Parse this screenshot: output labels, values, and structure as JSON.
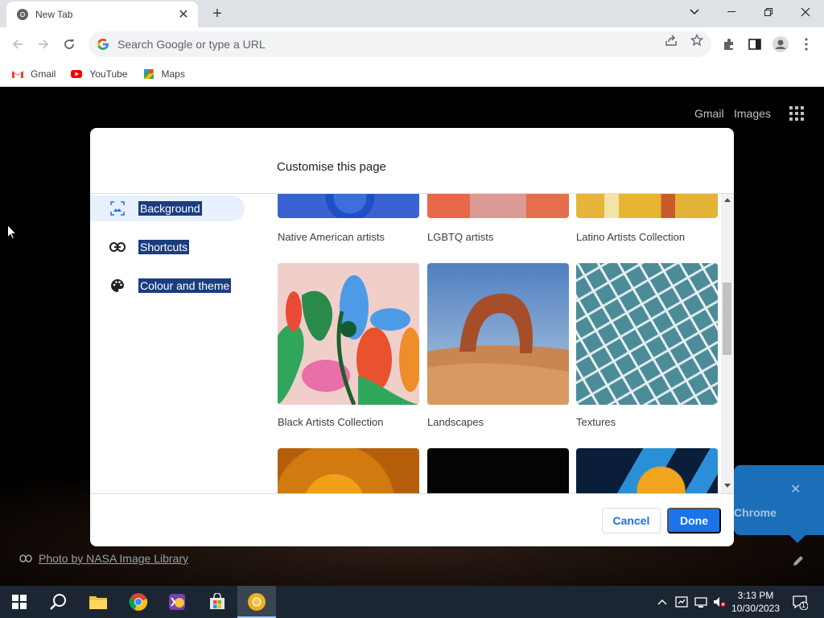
{
  "tab": {
    "title": "New Tab"
  },
  "omnibox": {
    "placeholder": "Search Google or type a URL"
  },
  "bookmarks": [
    {
      "label": "Gmail",
      "icon": "gmail-icon"
    },
    {
      "label": "YouTube",
      "icon": "youtube-icon"
    },
    {
      "label": "Maps",
      "icon": "maps-icon"
    }
  ],
  "ntp": {
    "gmail_link": "Gmail",
    "images_link": "Images",
    "attribution": "Photo by NASA Image Library",
    "promo_text": "Chrome"
  },
  "dialog": {
    "title": "Customise this page",
    "menu": [
      {
        "label": "Background",
        "icon": "image-icon",
        "active": true
      },
      {
        "label": "Shortcuts",
        "icon": "link-icon",
        "active": false
      },
      {
        "label": "Colour and theme",
        "icon": "palette-icon",
        "active": false
      }
    ],
    "collections_top": [
      "Native American artists",
      "LGBTQ artists",
      "Latino Artists Collection"
    ],
    "collections_mid": [
      "Black Artists Collection",
      "Landscapes",
      "Textures"
    ],
    "cancel_label": "Cancel",
    "done_label": "Done"
  },
  "taskbar": {
    "time": "3:13 PM",
    "date": "10/30/2023",
    "notification_count": "1"
  },
  "colors": {
    "accent": "#1a73e8",
    "selection": "#1a3d80",
    "taskbar": "#1c2633"
  }
}
